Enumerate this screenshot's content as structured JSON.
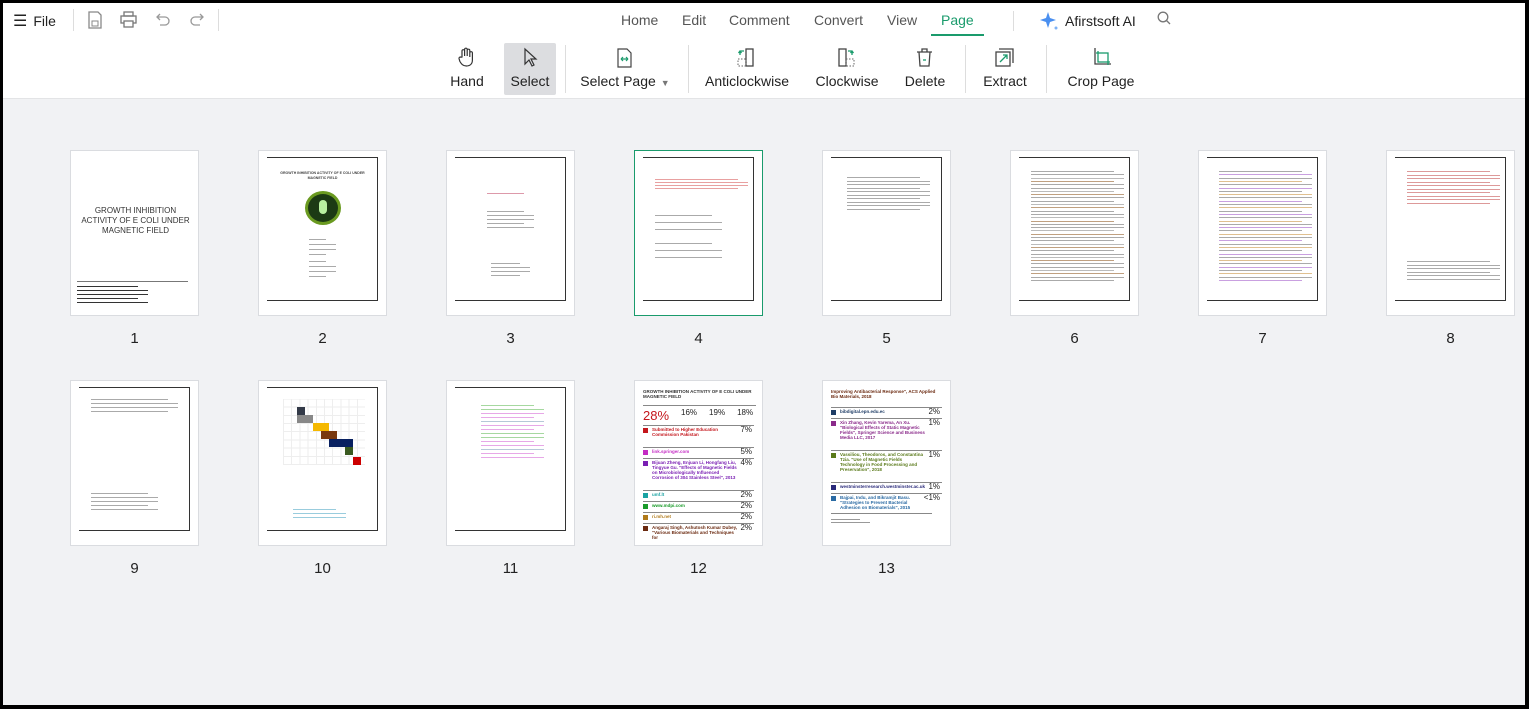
{
  "menu": {
    "file_label": "File",
    "icons": [
      "menu-icon",
      "save-icon",
      "print-icon",
      "undo-icon",
      "redo-icon"
    ]
  },
  "tabs": [
    {
      "label": "Home"
    },
    {
      "label": "Edit"
    },
    {
      "label": "Comment"
    },
    {
      "label": "Convert"
    },
    {
      "label": "View"
    },
    {
      "label": "Page",
      "active": true
    }
  ],
  "ai": {
    "label": "Afirstsoft AI"
  },
  "tools": [
    {
      "label": "Hand",
      "icon": "hand-icon"
    },
    {
      "label": "Select",
      "icon": "cursor-icon",
      "selected": true
    },
    {
      "label": "Select Page",
      "icon": "select-page-icon",
      "dropdown": true
    },
    {
      "label": "Anticlockwise",
      "icon": "rotate-anticlockwise-icon"
    },
    {
      "label": "Clockwise",
      "icon": "rotate-clockwise-icon"
    },
    {
      "label": "Delete",
      "icon": "trash-icon"
    },
    {
      "label": "Extract",
      "icon": "extract-icon"
    },
    {
      "label": "Crop Page",
      "icon": "crop-icon"
    }
  ],
  "accent": "#1a9b6c",
  "pages": [
    {
      "number": "1",
      "title": "GROWTH INHIBITION ACTIVITY OF E COLI UNDER MAGNETIC FIELD"
    },
    {
      "number": "2",
      "title": "GROWTH INHIBITION ACTIVITY OF E COLI UNDER MAGNETIC FIELD"
    },
    {
      "number": "3"
    },
    {
      "number": "4",
      "selected": true
    },
    {
      "number": "5"
    },
    {
      "number": "6"
    },
    {
      "number": "7"
    },
    {
      "number": "8"
    },
    {
      "number": "9"
    },
    {
      "number": "10"
    },
    {
      "number": "11"
    },
    {
      "number": "12",
      "title": "GROWTH INHIBITION ACTIVITY OF E COLI UNDER MAGNETIC FIELD",
      "scores": [
        "28%",
        "16%",
        "19%",
        "18%"
      ],
      "sources": [
        {
          "n": "1",
          "text": "Submitted to Higher Education Commission Pakistan",
          "pct": "7%",
          "color": "#c4161c"
        },
        {
          "n": "2",
          "text": "link.springer.com",
          "pct": "5%",
          "color": "#c42bc4"
        },
        {
          "n": "3",
          "text": "Bijuan Zheng, Enjuan Li, Hongfang Liu, Tingyue Gu. \"Effects of Magnetic Fields on Microbiologically Influenced Corrosion of 304 Stainless Steel\", 2013",
          "pct": "4%",
          "color": "#7a1fb3"
        },
        {
          "n": "4",
          "text": "umf.lt",
          "pct": "2%",
          "color": "#1aa3a3"
        },
        {
          "n": "5",
          "text": "www.mdpi.com",
          "pct": "2%",
          "color": "#1a9b2a"
        },
        {
          "n": "6",
          "text": "ri.mh.net",
          "pct": "2%",
          "color": "#b07a1a"
        },
        {
          "n": "7",
          "text": "Angaraj Singh, Ashutosh Kumar Dubey, \"Various Biomaterials and Techniques for",
          "pct": "2%",
          "color": "#6b2a10"
        }
      ]
    },
    {
      "number": "13",
      "title": "Improving Antibacterial Response\", ACS Applied Bio Materials, 2018",
      "sources": [
        {
          "n": "8",
          "text": "bibdigital.epn.edu.ec",
          "pct": "2%",
          "color": "#1f3d66"
        },
        {
          "n": "9",
          "text": "Xin Zhang, Kevin Yarema, An Xu. \"Biological Effects of Static Magnetic Fields\", Springer Science and Business Media LLC, 2017",
          "pct": "1%",
          "color": "#8a2a8a"
        },
        {
          "n": "10",
          "text": "Vassiliou, Theodoros, and Constantina Tzia. \"Use of Magnetic Fields Technology in Food Processing and Preservation\", 2018",
          "pct": "1%",
          "color": "#5a7a1a"
        },
        {
          "n": "11",
          "text": "westminsterresearch.westminster.ac.uk",
          "pct": "1%",
          "color": "#2a2a7a"
        },
        {
          "n": "12",
          "text": "Bajpai, Indu, and Bikramjit Basu. \"Strategies to Prevent Bacterial Adhesion on Biomaterials\", 2015",
          "pct": "<1%",
          "color": "#2a6aa3"
        }
      ]
    }
  ]
}
